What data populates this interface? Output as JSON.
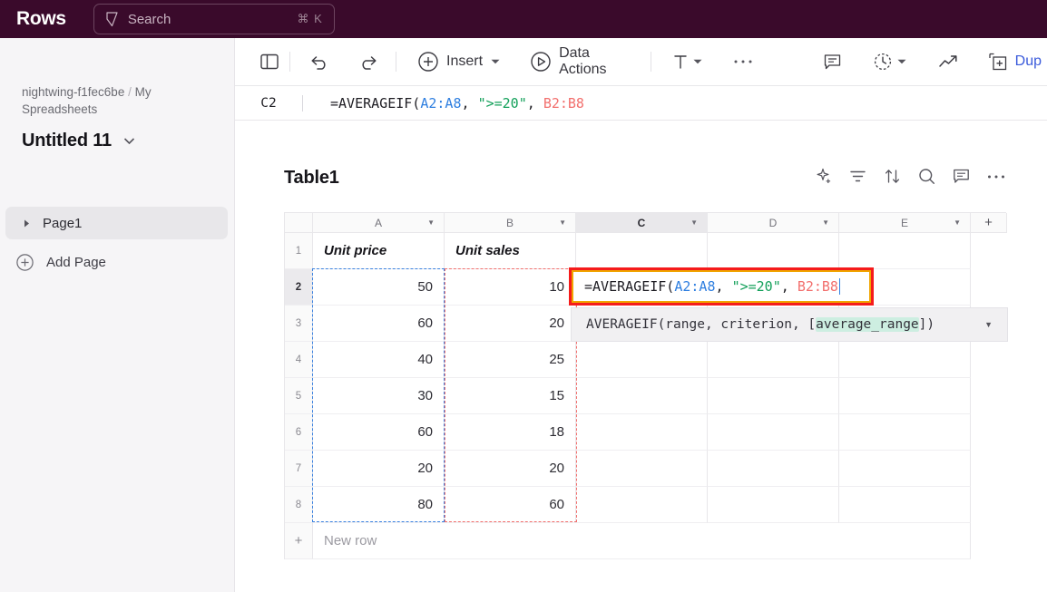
{
  "topbar": {
    "brand": "Rows",
    "search": {
      "placeholder": "Search",
      "shortcut": "⌘ K",
      "icon": "bolt-icon"
    }
  },
  "sidebar": {
    "breadcrumb": {
      "workspace": "nightwing-f1fec6be",
      "separator": "/",
      "folder": "My Spreadsheets"
    },
    "doc_title": "Untitled 11",
    "page_item": {
      "label": "Page1"
    },
    "add_page": {
      "label": "Add Page"
    }
  },
  "toolbar": {
    "panel_toggle": "panel-toggle-icon",
    "undo": "undo-icon",
    "redo": "redo-icon",
    "insert_label": "Insert",
    "data_actions_label": "Data Actions",
    "text_format": "T",
    "more_label": "…",
    "comment": "comment-icon",
    "history": "history-clock-icon",
    "trend": "trend-line-icon",
    "duplicate_label": "Dup"
  },
  "formula_bar": {
    "cell_ref": "C2",
    "formula": {
      "prefix": "=AVERAGEIF(",
      "arg1": "A2:A8",
      "comma1": ", ",
      "arg2": "\">=20\"",
      "comma2": ", ",
      "arg3": "B2:B8"
    }
  },
  "sheet": {
    "table_title": "Table1",
    "tools": [
      "ai-sparkle-icon",
      "filter-icon",
      "sort-icon",
      "search-icon",
      "comment-icon",
      "more-icon"
    ],
    "column_headers": [
      "A",
      "B",
      "C",
      "D",
      "E"
    ],
    "selected_column": "C",
    "add_column_label": "+",
    "row_numbers": [
      "1",
      "2",
      "3",
      "4",
      "5",
      "6",
      "7",
      "8"
    ],
    "active_row": "2",
    "header_row": {
      "a": "Unit price",
      "b": "Unit sales"
    },
    "rows": [
      {
        "n": "2",
        "a": "50",
        "b": "10"
      },
      {
        "n": "3",
        "a": "60",
        "b": "20"
      },
      {
        "n": "4",
        "a": "40",
        "b": "25"
      },
      {
        "n": "5",
        "a": "30",
        "b": "15"
      },
      {
        "n": "6",
        "a": "60",
        "b": "18"
      },
      {
        "n": "7",
        "a": "20",
        "b": "20"
      },
      {
        "n": "8",
        "a": "80",
        "b": "60"
      }
    ],
    "new_row": {
      "plus": "+",
      "label": "New row"
    },
    "cell_editor": {
      "prefix": "=AVERAGEIF(",
      "arg1": "A2:A8",
      "comma1": ", ",
      "arg2": "\">=20\"",
      "comma2": ", ",
      "arg3": "B2:B8"
    },
    "signature_tip": {
      "before": "AVERAGEIF(range, criterion, [",
      "highlight": "average_range",
      "after": "])"
    },
    "range_a_color": "#3b82e0",
    "range_b_color": "#f2706e"
  },
  "colors": {
    "topbar_bg": "#3a0a2b",
    "sidebar_bg": "#f6f5f7",
    "editor_outline": "#f51b1b",
    "editor_inline": "#f0a500",
    "token_range_a": "#2f7fe0",
    "token_range_b": "#f2706e",
    "token_string": "#13a05a",
    "duplicate_link": "#3b5bdb"
  }
}
